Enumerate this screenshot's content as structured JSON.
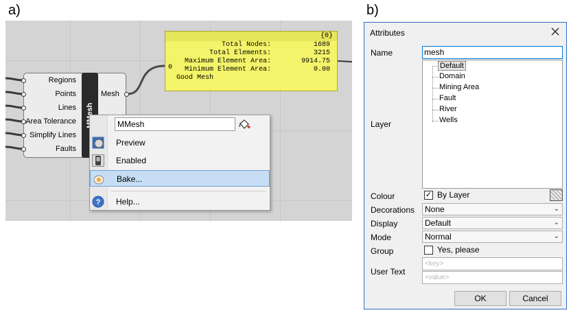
{
  "panel_a": {
    "label": "a)",
    "component": {
      "name": "MMesh",
      "inputs": [
        "Regions",
        "Points",
        "Lines",
        "Area Tolerance",
        "Simplify Lines",
        "Faults"
      ],
      "output": "Mesh"
    },
    "panel": {
      "header": "{0}",
      "index": "0",
      "rows": [
        {
          "key": "Total Nodes:",
          "value": "1689"
        },
        {
          "key": "Total Elements:",
          "value": "3215"
        },
        {
          "key": "Maximum Element Area:",
          "value": "9914.75"
        },
        {
          "key": "Minimum Element Area:",
          "value": "0.00"
        }
      ],
      "status": "Good Mesh"
    },
    "context_menu": {
      "name_value": "MMesh",
      "items": [
        {
          "label": "Preview",
          "icon": "preview-icon"
        },
        {
          "label": "Enabled",
          "icon": "enabled-icon"
        },
        {
          "label": "Bake...",
          "icon": "bake-icon",
          "highlighted": true
        },
        {
          "label": "Help...",
          "icon": "help-icon"
        }
      ]
    }
  },
  "panel_b": {
    "label": "b)",
    "dialog": {
      "title": "Attributes",
      "name_label": "Name",
      "name_value": "mesh",
      "layer_label": "Layer",
      "layers": [
        "Default",
        "Domain",
        "Mining Area",
        "Fault",
        "River",
        "Wells"
      ],
      "selected_layer": "Default",
      "colour_label": "Colour",
      "colour_check": "By Layer",
      "decorations_label": "Decorations",
      "decorations_value": "None",
      "display_label": "Display",
      "display_value": "Default",
      "mode_label": "Mode",
      "mode_value": "Normal",
      "group_label": "Group",
      "group_check": "Yes, please",
      "user_text_label": "User Text",
      "key_placeholder": "<key>",
      "value_placeholder": "<value>",
      "ok_label": "OK",
      "cancel_label": "Cancel"
    }
  },
  "colors": {
    "canvas": "#d4d4d4",
    "panel_yellow": "#f4f46a",
    "menu_highlight": "#c6ddf3",
    "dialog_accent": "#2b6cc4"
  }
}
